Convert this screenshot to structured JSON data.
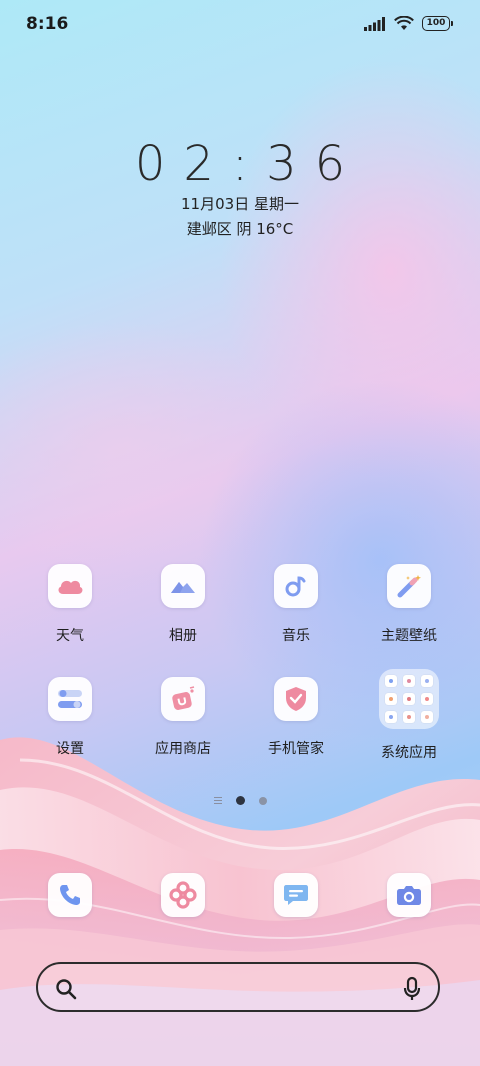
{
  "status_bar": {
    "time": "8:16",
    "battery": "100",
    "icons": [
      "signal-icon",
      "wifi-icon",
      "battery-icon"
    ]
  },
  "clock_widget": {
    "time": "02:36",
    "date": "11月03日 星期一",
    "weather": "建邺区 阴 16°C"
  },
  "home_apps": [
    {
      "label": "天气",
      "icon": "weather-cloud-icon"
    },
    {
      "label": "相册",
      "icon": "gallery-mountain-icon"
    },
    {
      "label": "音乐",
      "icon": "music-note-icon"
    },
    {
      "label": "主题壁纸",
      "icon": "theme-wand-icon"
    },
    {
      "label": "设置",
      "icon": "settings-toggle-icon"
    },
    {
      "label": "应用商店",
      "icon": "app-store-bag-icon"
    },
    {
      "label": "手机管家",
      "icon": "security-shield-icon"
    },
    {
      "label": "系统应用",
      "icon": "folder-grid-icon"
    }
  ],
  "page_indicator": {
    "pages": 2,
    "active": 1
  },
  "dock": [
    {
      "name": "phone",
      "icon": "phone-icon"
    },
    {
      "name": "browser",
      "icon": "browser-knot-icon"
    },
    {
      "name": "messages",
      "icon": "message-icon"
    },
    {
      "name": "camera",
      "icon": "camera-icon"
    }
  ],
  "search": {
    "placeholder": ""
  },
  "colors": {
    "accent_pink": "#e97a95",
    "accent_blue": "#7f9cf0",
    "text_dark": "#222222"
  }
}
